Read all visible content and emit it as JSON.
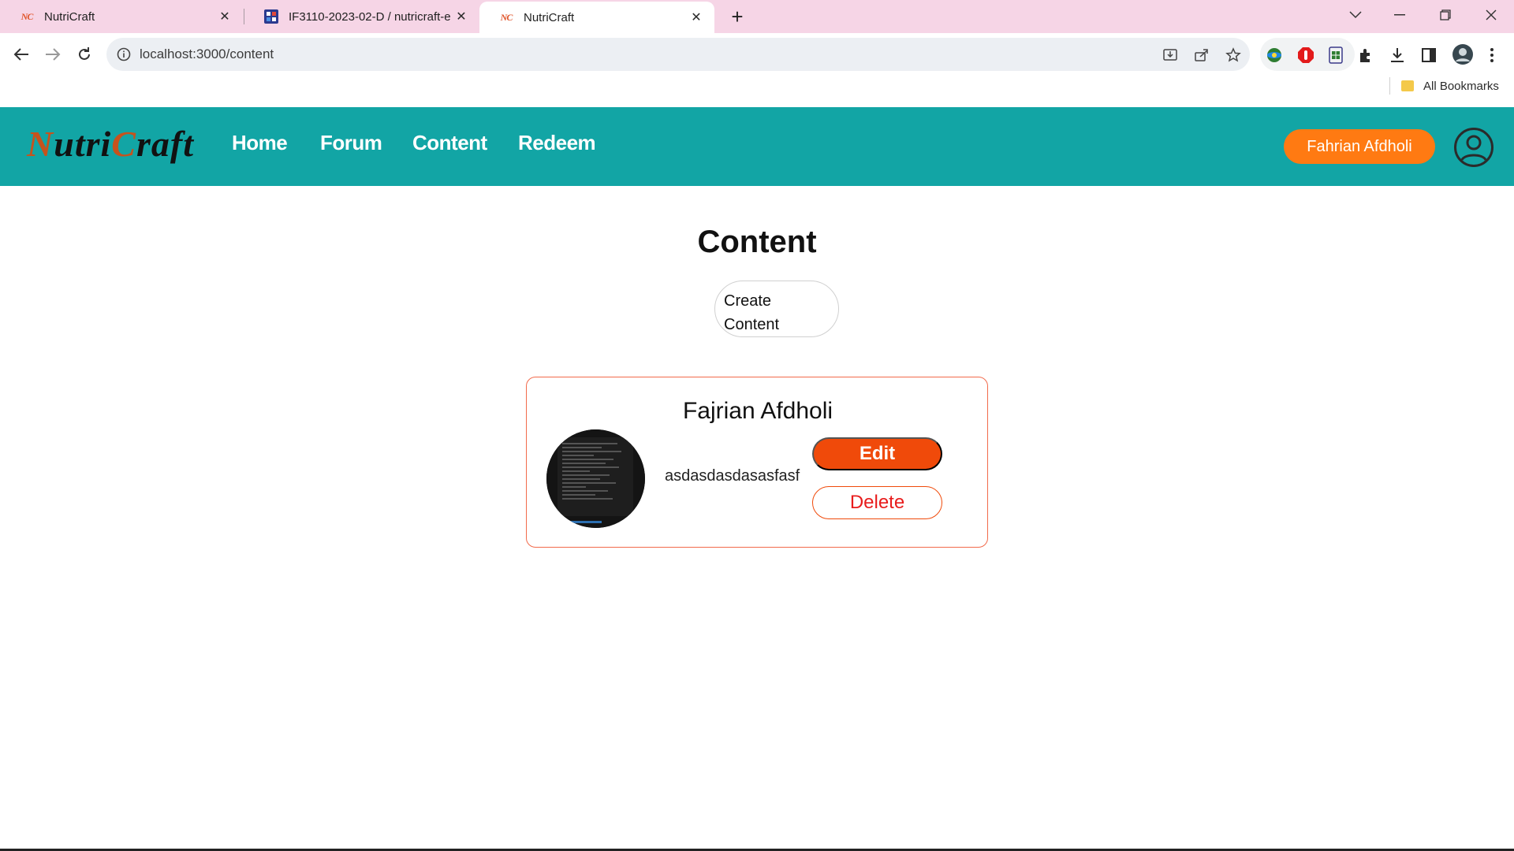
{
  "browser": {
    "tabs": [
      {
        "title": "NutriCraft",
        "favicon": "NC"
      },
      {
        "title": "IF3110-2023-02-D / nutricraft-e",
        "favicon": "repo-icon"
      },
      {
        "title": "NutriCraft",
        "favicon": "NC"
      }
    ],
    "url": "localhost:3000/content",
    "bookmarks_label": "All Bookmarks"
  },
  "navbar": {
    "brand_first": "N",
    "brand_mid": "utri",
    "brand_c": "C",
    "brand_rest": "raft",
    "links": [
      "Home",
      "Forum",
      "Content",
      "Redeem"
    ],
    "user_name": "Fahrian Afdholi"
  },
  "main": {
    "title": "Content",
    "create_label_1": "Create",
    "create_label_2": "Content",
    "cards": [
      {
        "author": "Fajrian Afdholi",
        "text": "asdasdasdasasfasf",
        "edit_label": "Edit",
        "delete_label": "Delete"
      }
    ]
  },
  "colors": {
    "tabstrip": "#f6d5e6",
    "navbar": "#12a5a5",
    "user_button": "#ff7a12",
    "edit_button": "#f04a0a",
    "delete_text": "#e81c1c",
    "card_border": "#f26a4b"
  }
}
